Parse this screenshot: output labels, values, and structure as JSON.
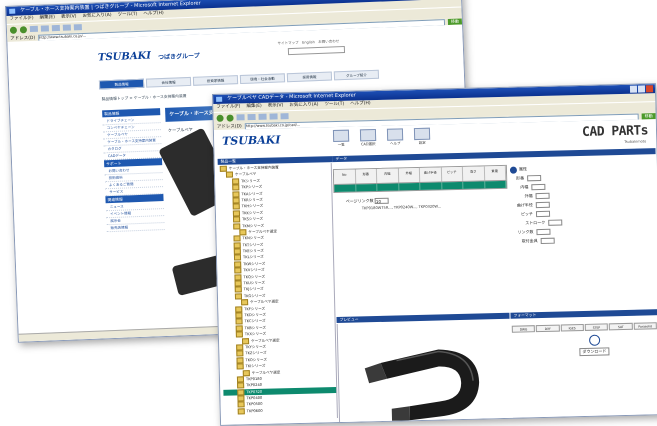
{
  "window1": {
    "title": "ケーブル・ホース支持案内装置 | つばきグループ - Microsoft Internet Explorer",
    "menu": [
      "ファイル(F)",
      "編集(E)",
      "表示(V)",
      "お気に入り(A)",
      "ツール(T)",
      "ヘルプ(H)"
    ],
    "address_label": "アドレス(D)",
    "address": "http://www.tsubaki.co.jp/...",
    "go_label": "移動",
    "logo": "TSUBAKI",
    "logo_sub": "つばきグループ",
    "header_links": "サイトマップ　English　お問い合わせ",
    "nav": [
      "製品情報",
      "会社情報",
      "投資家情報",
      "環境・社会活動",
      "採用情報",
      "グループ紹介"
    ],
    "breadcrumb": "製品情報トップ > ケーブル・ホース支持案内装置",
    "sidebar": {
      "header1": "製品情報",
      "items1": [
        "ドライブチェーン",
        "コンベヤチェーン",
        "ケーブルベヤ",
        "ケーブル・ホース支持案内装置",
        "カタログ",
        "CADデータ"
      ],
      "header2": "サポート",
      "items2": [
        "お問い合わせ",
        "技術資料",
        "よくあるご質問",
        "サービス"
      ],
      "header3": "関連情報",
      "items3": [
        "ニュース",
        "イベント情報",
        "展示会",
        "販売店情報"
      ]
    },
    "banner": "ケーブル・ホース支持案内装置",
    "lead": "ケーブルベヤ"
  },
  "window2": {
    "title": "ケーブルベヤ CADデータ - Microsoft Internet Explorer",
    "menu": [
      "ファイル(F)",
      "編集(E)",
      "表示(V)",
      "お気に入り(A)",
      "ツール(T)",
      "ヘルプ(H)"
    ],
    "address_label": "アドレス(D)",
    "address": "http://www.tsubaki.co.jp/cad/...",
    "go_label": "移動",
    "logo": "TSUBAKI",
    "top_icons": [
      "一覧",
      "CAD選択",
      "ヘルプ",
      "設定"
    ],
    "cad_logo": "CAD PARTs",
    "cad_sub": "Tsubakimoto",
    "tree_header": "製品一覧",
    "tree": [
      "ケーブル・ホース支持案内装置",
      "ケーブルベヤ",
      "TKシリーズ",
      "TKPシリーズ",
      "TKAシリーズ",
      "TKRシリーズ",
      "TKHシリーズ",
      "TKKシリーズ",
      "TKSシリーズ",
      "TKMシリーズ",
      "ケーブルベヤ選定",
      "TKNシリーズ",
      "TKTシリーズ",
      "TKEシリーズ",
      "TKLシリーズ",
      "TKWシリーズ",
      "TKVシリーズ",
      "TKQシリーズ",
      "TKUシリーズ",
      "TKJシリーズ",
      "TKGシリーズ",
      "ケーブルベヤ選定",
      "TKFシリーズ",
      "TKDシリーズ",
      "TKCシリーズ",
      "TKBシリーズ",
      "TKXシリーズ",
      "ケーブルベヤ選定",
      "TKYシリーズ",
      "TKZシリーズ",
      "TKOシリーズ",
      "TKIシリーズ",
      "ケーブルベヤ選定",
      "TKP0180",
      "TKP0240",
      "TKP0320",
      "TKP0400",
      "TKP0500",
      "TKP0600"
    ],
    "tree_selected_index": 35,
    "grid_header": "データ",
    "grid_columns": [
      "No",
      "形番",
      "内幅",
      "外幅",
      "曲げ半径",
      "ピッチ",
      "高さ",
      "質量"
    ],
    "calc_label": "ページリンク数",
    "calc_value": "10",
    "note": "TKP0180W75R..., TKP0240W..., TKP0320W...",
    "props_header": "属性",
    "props": [
      "形番",
      "内幅",
      "外幅",
      "曲げ半径",
      "ピッチ",
      "ストローク",
      "リンク数",
      "取付金具"
    ],
    "preview_header": "プレビュー",
    "right_header": "フォーマット",
    "tabs": [
      "DWG",
      "DXF",
      "IGES",
      "STEP",
      "SAT",
      "Parasolid"
    ],
    "download_label": "ダウンロード"
  }
}
